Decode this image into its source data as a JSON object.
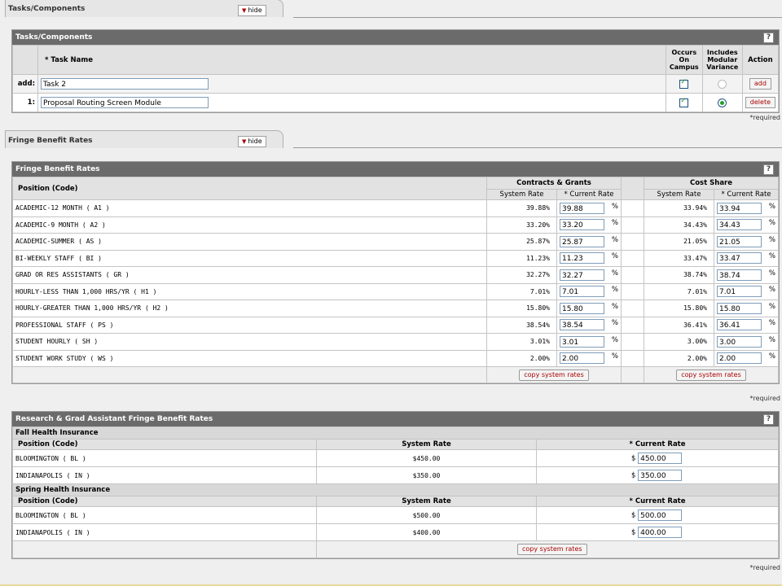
{
  "tasks_tab": {
    "title": "Tasks/Components",
    "hide_label": "hide",
    "panel_title": "Tasks/Components",
    "help": "?",
    "headers": {
      "task_name": "* Task Name",
      "occurs": "Occurs On Campus",
      "modular": "Includes Modular Variance",
      "action": "Action"
    },
    "add_row": {
      "label": "add:",
      "value": "Task 2",
      "action": "add"
    },
    "rows": [
      {
        "index": "1:",
        "value": "Proposal Routing Screen Module",
        "action": "delete"
      }
    ],
    "required": "*required"
  },
  "fringe_tab": {
    "title": "Fringe Benefit Rates",
    "hide_label": "hide",
    "panel_title": "Fringe Benefit Rates",
    "help": "?",
    "headers": {
      "position": "Position (Code)",
      "contracts": "Contracts & Grants",
      "cost_share": "Cost Share",
      "system_rate": "System Rate",
      "current_rate": "* Current Rate"
    },
    "percent": "%",
    "rows": [
      {
        "name": "ACADEMIC-12 MONTH ( A1 )",
        "cg_sys": "39.88%",
        "cg_cur": "39.88",
        "cs_sys": "33.94%",
        "cs_cur": "33.94"
      },
      {
        "name": "ACADEMIC-9 MONTH ( A2 )",
        "cg_sys": "33.20%",
        "cg_cur": "33.20",
        "cs_sys": "34.43%",
        "cs_cur": "34.43"
      },
      {
        "name": "ACADEMIC-SUMMER ( AS )",
        "cg_sys": "25.87%",
        "cg_cur": "25.87",
        "cs_sys": "21.05%",
        "cs_cur": "21.05"
      },
      {
        "name": "BI-WEEKLY STAFF ( BI )",
        "cg_sys": "11.23%",
        "cg_cur": "11.23",
        "cs_sys": "33.47%",
        "cs_cur": "33.47"
      },
      {
        "name": "GRAD OR RES ASSISTANTS ( GR )",
        "cg_sys": "32.27%",
        "cg_cur": "32.27",
        "cs_sys": "38.74%",
        "cs_cur": "38.74"
      },
      {
        "name": "HOURLY-LESS THAN 1,000 HRS/YR ( H1 )",
        "cg_sys": "7.01%",
        "cg_cur": "7.01",
        "cs_sys": "7.01%",
        "cs_cur": "7.01"
      },
      {
        "name": "HOURLY-GREATER THAN 1,000 HRS/YR ( H2 )",
        "cg_sys": "15.80%",
        "cg_cur": "15.80",
        "cs_sys": "15.80%",
        "cs_cur": "15.80"
      },
      {
        "name": "PROFESSIONAL STAFF ( PS )",
        "cg_sys": "38.54%",
        "cg_cur": "38.54",
        "cs_sys": "36.41%",
        "cs_cur": "36.41"
      },
      {
        "name": "STUDENT HOURLY ( SH )",
        "cg_sys": "3.01%",
        "cg_cur": "3.01",
        "cs_sys": "3.00%",
        "cs_cur": "3.00"
      },
      {
        "name": "STUDENT WORK STUDY ( WS )",
        "cg_sys": "2.00%",
        "cg_cur": "2.00",
        "cs_sys": "2.00%",
        "cs_cur": "2.00"
      }
    ],
    "copy_label": "copy system rates",
    "required": "*required"
  },
  "grad_panel": {
    "title": "Research & Grad Assistant Fringe Benefit Rates",
    "help": "?",
    "headers": {
      "position": "Position (Code)",
      "system_rate": "System Rate",
      "current_rate": "* Current Rate"
    },
    "currency": "$",
    "fall": {
      "title": "Fall Health Insurance",
      "rows": [
        {
          "name": "BLOOMINGTON ( BL )",
          "sys": "$450.00",
          "cur": "450.00"
        },
        {
          "name": "INDIANAPOLIS ( IN )",
          "sys": "$350.00",
          "cur": "350.00"
        }
      ]
    },
    "spring": {
      "title": "Spring Health Insurance",
      "rows": [
        {
          "name": "BLOOMINGTON ( BL )",
          "sys": "$500.00",
          "cur": "500.00"
        },
        {
          "name": "INDIANAPOLIS ( IN )",
          "sys": "$400.00",
          "cur": "400.00"
        }
      ]
    },
    "copy_label": "copy system rates",
    "required": "*required"
  }
}
